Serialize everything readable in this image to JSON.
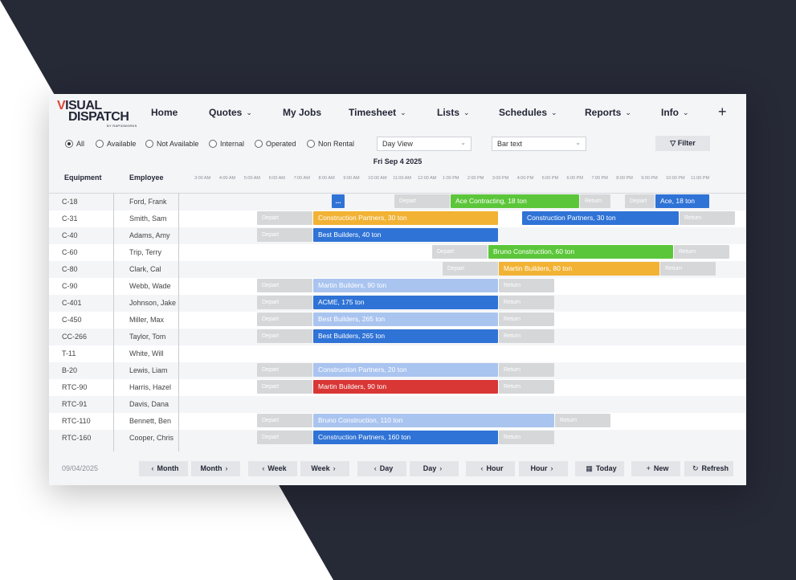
{
  "logo": {
    "line1_accent": "V",
    "line1_rest": "ISUAL",
    "line2": "DISPATCH",
    "tagline": "BY RAPIDWORKS"
  },
  "nav": [
    {
      "label": "Home",
      "chevron": false
    },
    {
      "label": "Quotes",
      "chevron": true
    },
    {
      "label": "My Jobs",
      "chevron": false
    },
    {
      "label": "Timesheet",
      "chevron": true
    },
    {
      "label": "Lists",
      "chevron": true
    },
    {
      "label": "Schedules",
      "chevron": true
    },
    {
      "label": "Reports",
      "chevron": true
    },
    {
      "label": "Info",
      "chevron": true
    }
  ],
  "nav_plus": "+",
  "filters": {
    "radios": [
      {
        "label": "All",
        "selected": true
      },
      {
        "label": "Available",
        "selected": false
      },
      {
        "label": "Not Available",
        "selected": false
      },
      {
        "label": "Internal",
        "selected": false
      },
      {
        "label": "Operated",
        "selected": false
      },
      {
        "label": "Non Rental",
        "selected": false
      }
    ],
    "view_select": "Day View",
    "bar_select": "Bar text",
    "filter_button": "Filter"
  },
  "date_label": "Fri Sep 4 2025",
  "columns": {
    "equipment": "Equipment",
    "employee": "Employee"
  },
  "hours": [
    "3:00 AM",
    "4:00 AM",
    "5:00 AM",
    "6:00 AM",
    "7:00 AM",
    "8:00 AM",
    "9:00 AM",
    "10:00 AM",
    "11:00 AM",
    "12:00 AM",
    "1:00 PM",
    "2:00 PM",
    "3:00 PM",
    "4:00 PM",
    "5:00 PM",
    "6:00 PM",
    "7:00 PM",
    "8:00 PM",
    "9:00 PM",
    "10:00 PM",
    "11:00 PM"
  ],
  "rows": [
    {
      "equipment": "C-18",
      "employee": "Ford, Frank"
    },
    {
      "equipment": "C-31",
      "employee": "Smith, Sam"
    },
    {
      "equipment": "C-40",
      "employee": "Adams, Amy"
    },
    {
      "equipment": "C-60",
      "employee": "Trip, Terry"
    },
    {
      "equipment": "C-80",
      "employee": "Clark, Cal"
    },
    {
      "equipment": "C-90",
      "employee": "Webb, Wade"
    },
    {
      "equipment": "C-401",
      "employee": "Johnson, Jake"
    },
    {
      "equipment": "C-450",
      "employee": "Miller, Max"
    },
    {
      "equipment": "CC-266",
      "employee": "Taylor, Tom"
    },
    {
      "equipment": "T-11",
      "employee": "White, Will"
    },
    {
      "equipment": "B-20",
      "employee": "Lewis, Liam"
    },
    {
      "equipment": "RTC-90",
      "employee": "Harris, Hazel"
    },
    {
      "equipment": "RTC-91",
      "employee": "Davis, Dana"
    },
    {
      "equipment": "RTC-110",
      "employee": "Bennett, Ben"
    },
    {
      "equipment": "RTC-160",
      "employee": "Cooper, Chris"
    }
  ],
  "bar_labels": {
    "ellipsis": "...",
    "depart": "Depart",
    "return": "Return",
    "ace_contracting": "Ace Contracting, 18 ton",
    "ace": "Ace, 18 ton",
    "construction_partners_30": "Construction Partners, 30 ton",
    "best_builders_40": "Best Builders, 40 ton",
    "bruno_60": "Bruno Construction, 60 ton",
    "martin_80": "Martin Builders, 80 ton",
    "martin_90": "Martin Builders, 90 ton",
    "acme_175": "ACME, 175 ton",
    "best_builders_265": "Best Builders, 265 ton",
    "construction_partners_20": "Construction Partners, 20 ton",
    "bruno_110": "Bruno Construction, 110 ton",
    "construction_partners_160": "Construction Partners, 160 ton"
  },
  "bottom": {
    "date": "09/04/2025",
    "buttons": {
      "prev_month": "Month",
      "next_month": "Month",
      "prev_week": "Week",
      "next_week": "Week",
      "prev_day": "Day",
      "next_day": "Day",
      "prev_hour": "Hour",
      "next_hour": "Hour",
      "today": "Today",
      "new": "New",
      "refresh": "Refresh"
    }
  },
  "colors": {
    "background_dark": "#262936",
    "orange": "#f2b233",
    "blue": "#2f73d6",
    "light_blue": "#a9c4ef",
    "green": "#5cc63a",
    "red": "#d93636",
    "gray": "#d6d7d9",
    "logo_accent": "#e2442f"
  }
}
